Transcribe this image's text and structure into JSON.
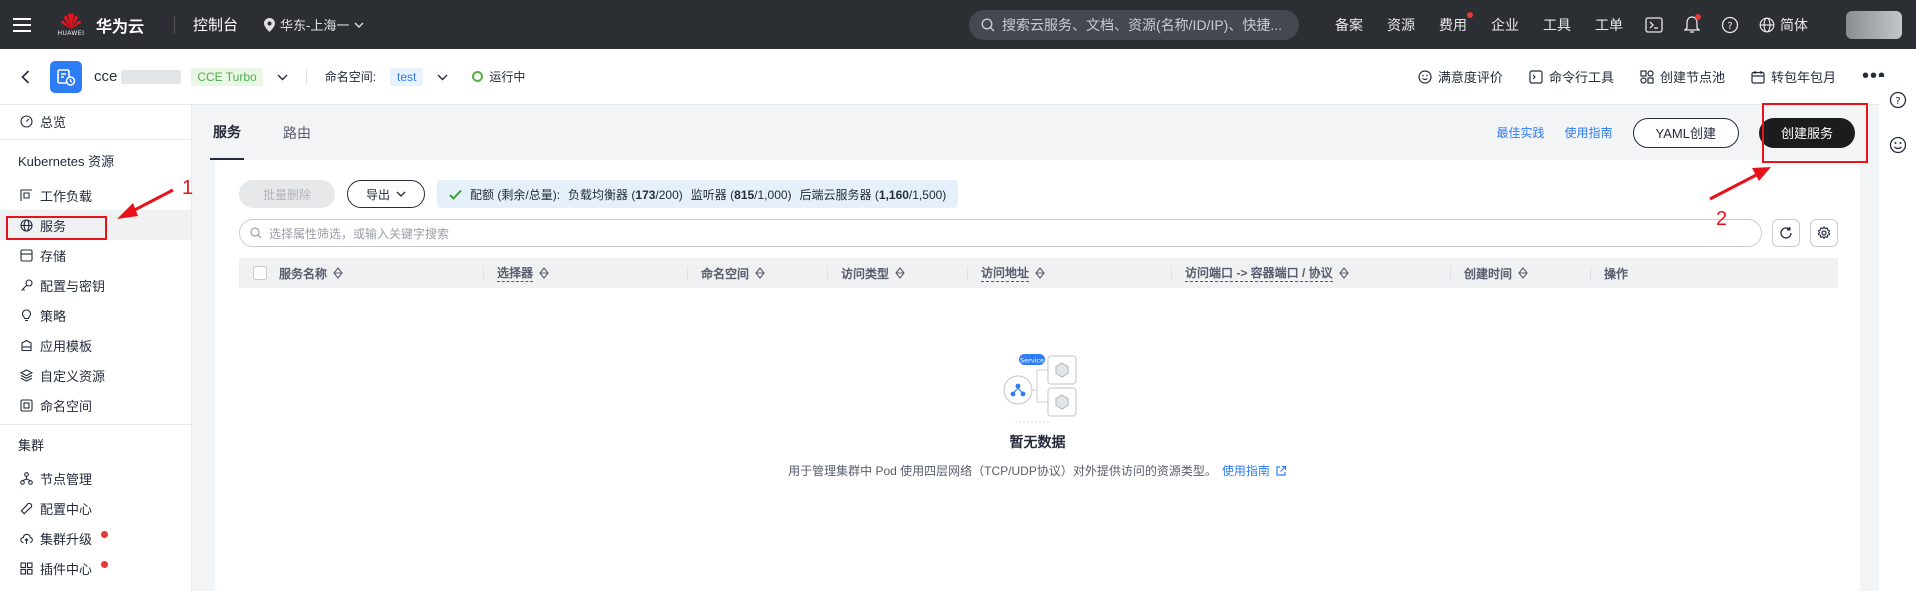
{
  "topbar": {
    "brand": "华为云",
    "logo_label": "HUAWEI",
    "console": "控制台",
    "region": "华东-上海一",
    "search_placeholder": "搜索云服务、文档、资源(名称/ID/IP)、快捷...",
    "links": [
      "备案",
      "资源",
      "费用",
      "企业",
      "工具",
      "工单"
    ],
    "language": "简体"
  },
  "subbar": {
    "cluster_name": "cce",
    "cluster_type": "CCE Turbo",
    "namespace_label": "命名空间:",
    "namespace": "test",
    "status": "运行中",
    "actions": [
      "满意度评价",
      "命令行工具",
      "创建节点池",
      "转包年包月"
    ]
  },
  "sidebar": {
    "overview": "总览",
    "group_k8s": "Kubernetes 资源",
    "k8s_items": [
      "工作负载",
      "服务",
      "存储",
      "配置与密钥",
      "策略",
      "应用模板",
      "自定义资源",
      "命名空间"
    ],
    "group_cluster": "集群",
    "cluster_items": [
      "节点管理",
      "配置中心",
      "集群升级",
      "插件中心"
    ]
  },
  "main": {
    "tabs": [
      "服务",
      "路由"
    ],
    "best_practice": "最佳实践",
    "guide": "使用指南",
    "yaml_create": "YAML创建",
    "create_service": "创建服务"
  },
  "toolbar": {
    "batch_delete": "批量删除",
    "export": "导出",
    "quota_prefix": "配额 (剩余/总量):",
    "lb_label": "负载均衡器",
    "lb_remain": "173",
    "lb_total": "/200)",
    "listener_label": "监听器",
    "listener_remain": "815",
    "listener_total": "/1,000)",
    "backend_label": "后端云服务器",
    "backend_remain": "1,160",
    "backend_total": "/1,500)"
  },
  "search": {
    "placeholder": "选择属性筛选，或输入关键字搜索"
  },
  "table": {
    "headers": [
      "服务名称",
      "选择器",
      "命名空间",
      "访问类型",
      "访问地址",
      "访问端口 -> 容器端口 / 协议",
      "创建时间",
      "操作"
    ]
  },
  "empty": {
    "badge": "Service",
    "title": "暂无数据",
    "description": "用于管理集群中 Pod 使用四层网络（TCP/UDP协议）对外提供访问的资源类型。",
    "link": "使用指南"
  },
  "annotations": {
    "num1": "1",
    "num2": "2"
  },
  "colors": {
    "accent": "#2e7cf6",
    "topbar": "#2b2e33",
    "annotation": "#e8131a",
    "running": "#56b142"
  }
}
